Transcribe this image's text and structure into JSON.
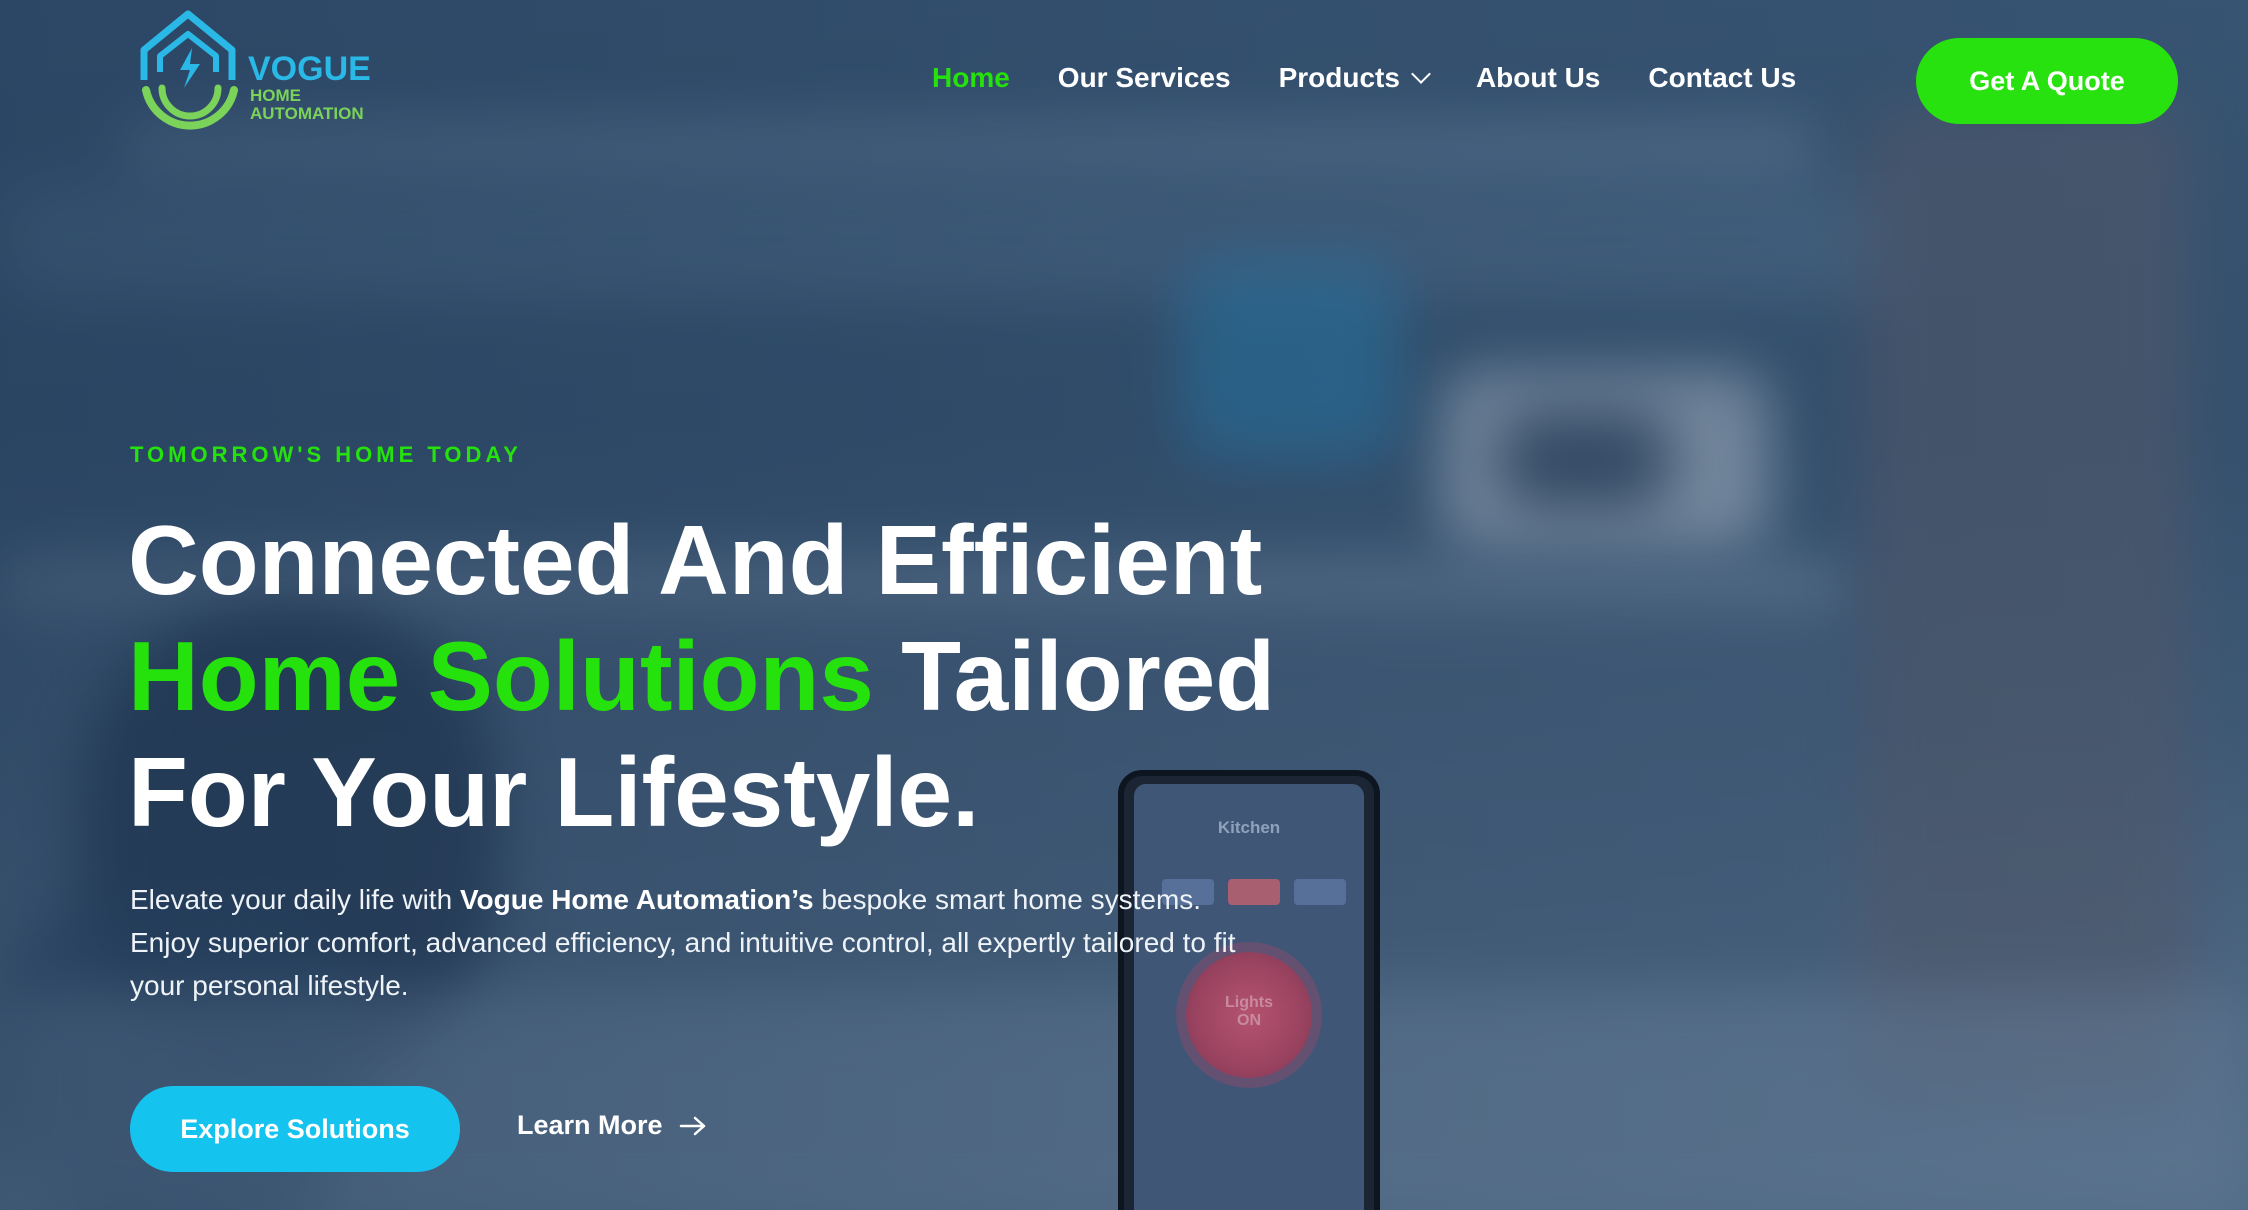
{
  "brand": {
    "name": "VOGUE",
    "sub_line_1": "HOME",
    "sub_line_2": "AUTOMATION",
    "colors": {
      "primary_green": "#25e10c",
      "primary_blue": "#15c3ef",
      "logo_blue": "#2ab8e6",
      "logo_green": "#7bd35a"
    }
  },
  "nav": {
    "items": [
      {
        "label": "Home",
        "active": true
      },
      {
        "label": "Our Services",
        "active": false
      },
      {
        "label": "Products",
        "active": false,
        "has_dropdown": true
      },
      {
        "label": "About Us",
        "active": false
      },
      {
        "label": "Contact Us",
        "active": false
      }
    ],
    "cta_label": "Get A Quote"
  },
  "hero": {
    "eyebrow": "TOMORROW'S HOME TODAY",
    "headline_line1": "Connected And Efficient",
    "headline_green": "Home Solutions",
    "headline_line2_rest": "Tailored",
    "headline_line3": "For Your Lifestyle.",
    "desc_prefix": "Elevate your daily life with ",
    "desc_brand": "Vogue Home Automation’s",
    "desc_suffix": " bespoke smart home systems. Enjoy superior comfort, advanced efficiency, and intuitive control, all expertly tailored to fit your personal lifestyle.",
    "primary_button": "Explore Solutions",
    "secondary_link": "Learn More",
    "secondary_icon": "arrow-right-icon"
  },
  "phone": {
    "screen_title": "Kitchen",
    "dial_label_1": "Lights",
    "dial_label_2": "ON"
  }
}
